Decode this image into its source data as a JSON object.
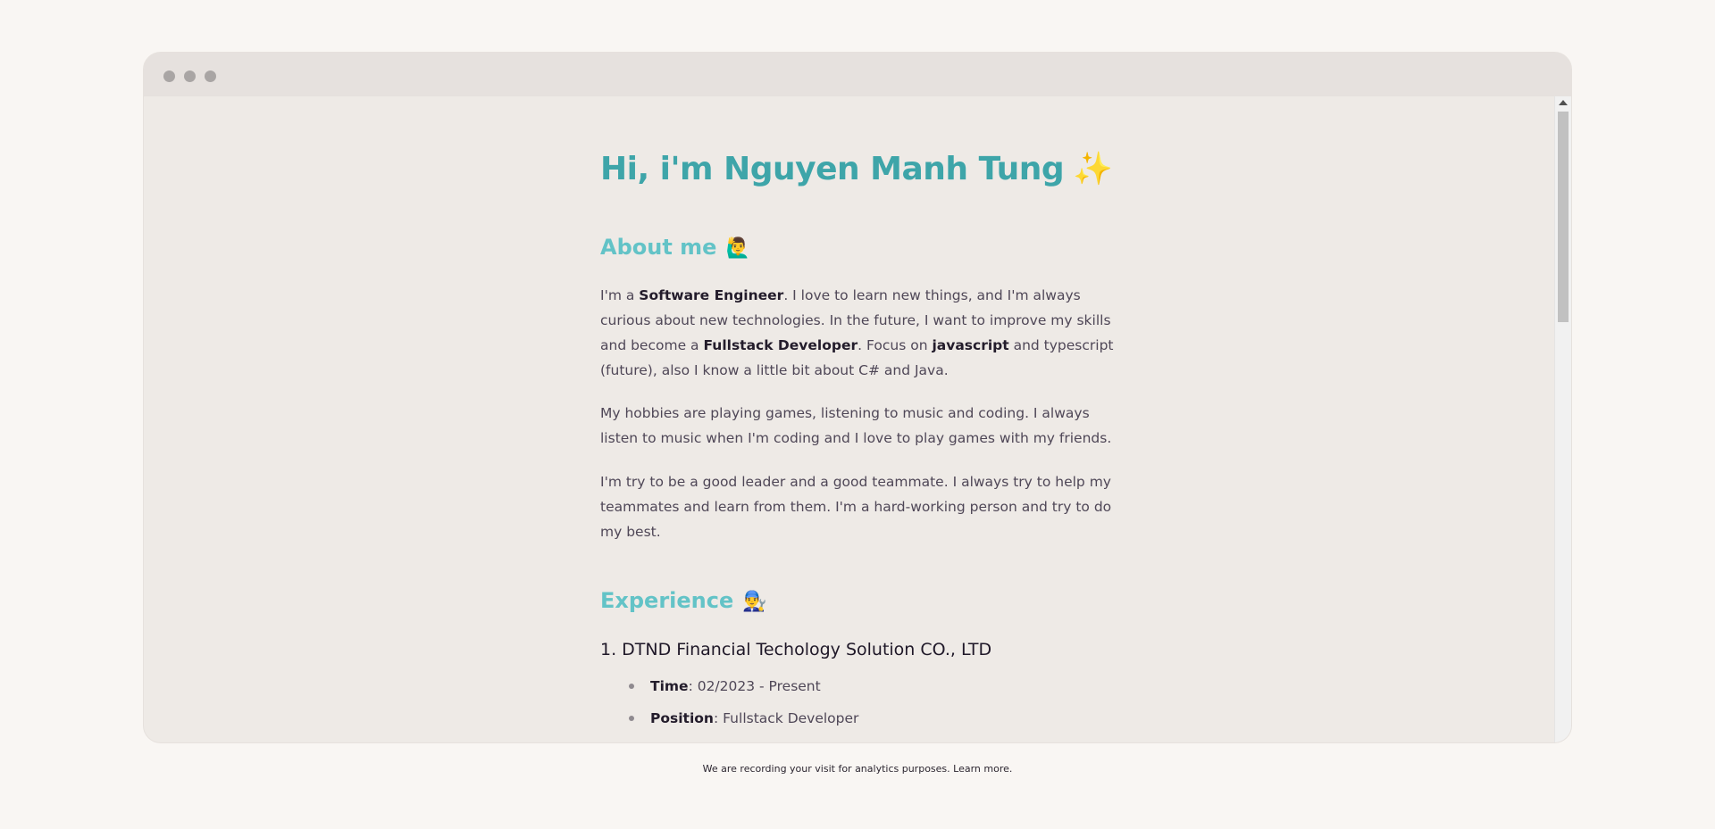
{
  "page": {
    "title_text": "Hi, i'm Nguyen Manh Tung",
    "title_emoji": "✨"
  },
  "about": {
    "heading": "About me",
    "heading_emoji": "🙋‍♂️",
    "p1": {
      "t1": "I'm a ",
      "b1": "Software Engineer",
      "t2": ". I love to learn new things, and I'm always curious about new technologies. In the future, I want to improve my skills and become a ",
      "b2": "Fullstack Developer",
      "t3": ". Focus on ",
      "b3": "javascript",
      "t4": " and typescript (future), also I know a little bit about C# and Java."
    },
    "p2": "My hobbies are playing games, listening to music and coding. I always listen to music when I'm coding and I love to play games with my friends.",
    "p3": "I'm try to be a good leader and a good teammate. I always try to help my teammates and learn from them. I'm a hard-working person and try to do my best."
  },
  "experience": {
    "heading": "Experience",
    "heading_emoji": "👨‍🔧",
    "job1": {
      "title": "1. DTND Financial Techology Solution CO., LTD",
      "time_label": "Time",
      "time_value": ": 02/2023 - Present",
      "position_label": "Position",
      "position_value": ": Fullstack Developer"
    }
  },
  "footer": {
    "text": "We are recording your visit for analytics purposes. Learn more."
  },
  "colors": {
    "title": "#3ea5a9",
    "heading": "#63c3c7",
    "background": "#f9f6f3"
  }
}
